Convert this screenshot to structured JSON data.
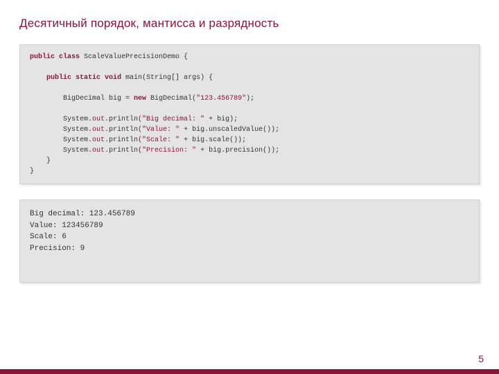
{
  "title": "Десятичный порядок, мантисса и разрядность",
  "page_number": "5",
  "code": {
    "l1_kw1": "public class",
    "l1_t": " ScaleValuePrecisionDemo {",
    "l3_kw1": "public static void",
    "l3_t": " main(String[] args) {",
    "l5_t1": "        BigDecimal big = ",
    "l5_kw": "new",
    "l5_t2": " BigDecimal(",
    "l5_str": "\"123.456789\"",
    "l5_t3": ");",
    "l7_t1": "        System.",
    "l7_f": "out",
    "l7_t2": ".println(",
    "l7_s": "\"Big decimal: \"",
    "l7_t3": " + big);",
    "l8_t1": "        System.",
    "l8_f": "out",
    "l8_t2": ".println(",
    "l8_s": "\"Value: \"",
    "l8_t3": " + big.unscaledValue());",
    "l9_t1": "        System.",
    "l9_f": "out",
    "l9_t2": ".println(",
    "l9_s": "\"Scale: \"",
    "l9_t3": " + big.scale());",
    "l10_t1": "        System.",
    "l10_f": "out",
    "l10_t2": ".println(",
    "l10_s": "\"Precision: \"",
    "l10_t3": " + big.precision());",
    "l11": "    }",
    "l12": "}"
  },
  "output": {
    "l1": "Big decimal: 123.456789",
    "l2": "Value: 123456789",
    "l3": "Scale: 6",
    "l4": "Precision: 9"
  }
}
